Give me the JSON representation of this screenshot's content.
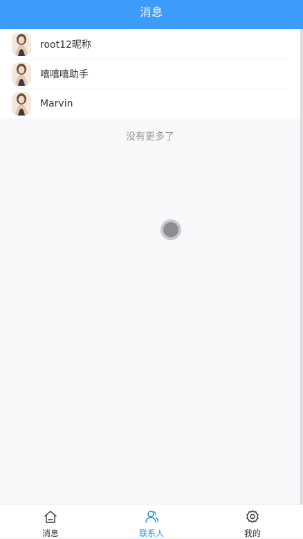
{
  "header": {
    "title": "消息"
  },
  "contacts": [
    {
      "name": "root12昵称"
    },
    {
      "name": "嘻嘻嘻助手"
    },
    {
      "name": "Marvin"
    }
  ],
  "list_footer": "没有更多了",
  "tabbar": {
    "items": [
      {
        "label": "消息",
        "icon": "home-icon",
        "active": false
      },
      {
        "label": "联系人",
        "icon": "contacts-icon",
        "active": true
      },
      {
        "label": "我的",
        "icon": "settings-icon",
        "active": false
      }
    ]
  },
  "colors": {
    "header_bg": "#3d9bfa",
    "active_tab": "#1989fa",
    "page_bg": "#f7f8fa"
  }
}
